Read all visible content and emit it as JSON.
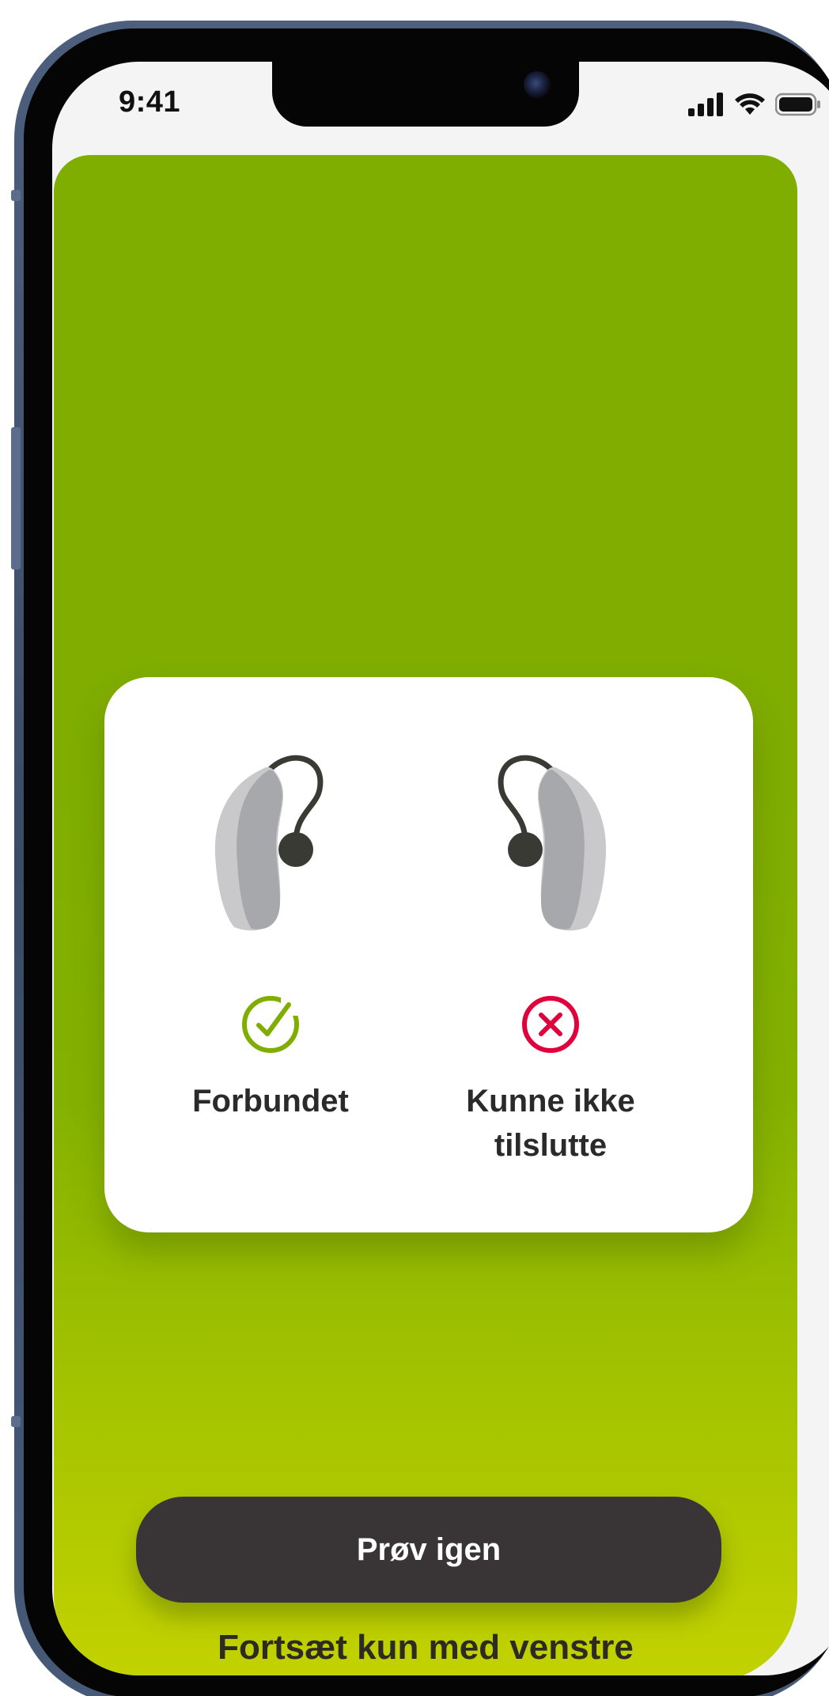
{
  "status_bar": {
    "time": "9:41",
    "icons": [
      "cellular-signal-icon",
      "wifi-icon",
      "battery-icon"
    ]
  },
  "colors": {
    "panel_top": "#7fad00",
    "panel_bottom": "#c3d200",
    "success": "#7fad00",
    "error": "#e0003c",
    "button_bg": "#393536",
    "text_dark": "#2a2a2a"
  },
  "card": {
    "left_aid": {
      "icon": "hearing-aid-left-icon",
      "state_icon": "check-circle-icon",
      "state": "Forbundet"
    },
    "right_aid": {
      "icon": "hearing-aid-right-icon",
      "state_icon": "x-circle-icon",
      "state": "Kunne ikke\ntilslutte"
    }
  },
  "actions": {
    "retry_label": "Prøv igen",
    "continue_label": "Fortsæt kun med venstre"
  }
}
